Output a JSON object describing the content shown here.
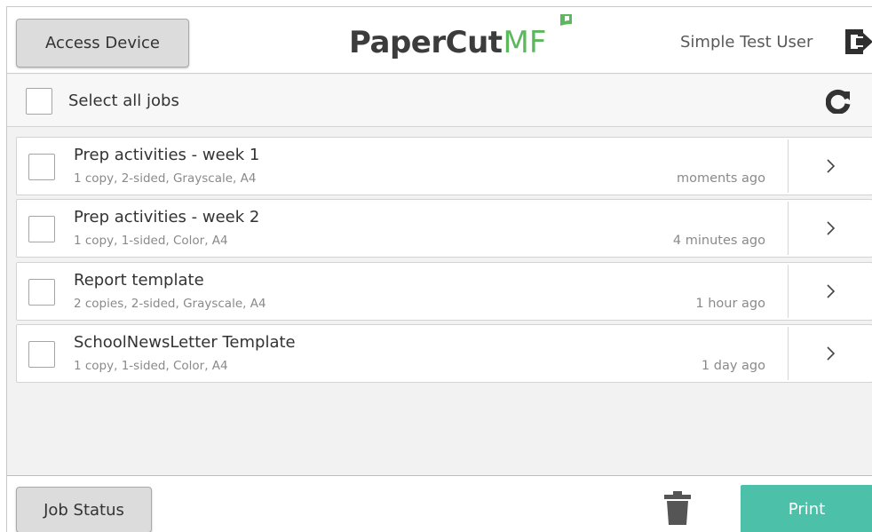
{
  "header": {
    "access_device_label": "Access Device",
    "logo": {
      "main": "PaperCut",
      "suffix": "MF"
    },
    "user_name": "Simple Test User"
  },
  "select_bar": {
    "select_all_label": "Select all jobs"
  },
  "jobs": [
    {
      "title": "Prep activities - week 1",
      "details": "1 copy, 2-sided, Grayscale, A4",
      "time": "moments ago"
    },
    {
      "title": "Prep activities - week 2",
      "details": "1 copy, 1-sided, Color, A4",
      "time": "4 minutes ago"
    },
    {
      "title": "Report template",
      "details": "2 copies, 2-sided, Grayscale, A4",
      "time": "1 hour ago"
    },
    {
      "title": "SchoolNewsLetter Template",
      "details": "1 copy, 1-sided, Color, A4",
      "time": "1 day ago"
    }
  ],
  "footer": {
    "job_status_label": "Job Status",
    "print_label": "Print"
  },
  "colors": {
    "accent": "#4cc0a8",
    "logo_green": "#5cb85c"
  },
  "icons": {
    "logout": "logout-icon",
    "refresh": "refresh-icon",
    "chevron": "chevron-right-icon",
    "trash": "trash-icon",
    "leaf": "leaf-icon"
  }
}
